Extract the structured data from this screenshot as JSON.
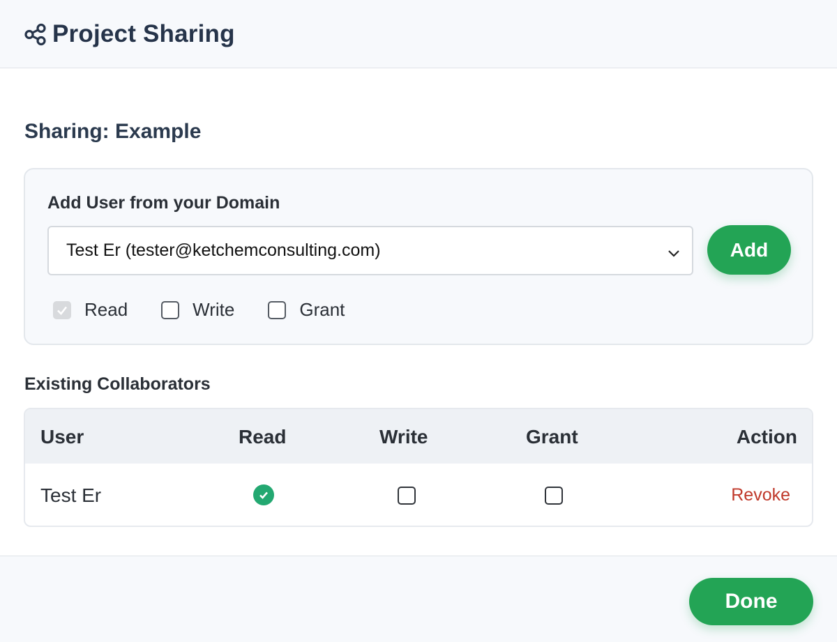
{
  "header": {
    "title": "Project Sharing",
    "icon": "share-icon"
  },
  "body": {
    "section_title": "Sharing: Example",
    "add_user": {
      "label": "Add User from your Domain",
      "selected_user": "Test Er (tester@ketchemconsulting.com)",
      "add_button_label": "Add",
      "permissions": [
        {
          "label": "Read",
          "checked": true,
          "disabled": true
        },
        {
          "label": "Write",
          "checked": false,
          "disabled": false
        },
        {
          "label": "Grant",
          "checked": false,
          "disabled": false
        }
      ]
    },
    "collaborators": {
      "title": "Existing Collaborators",
      "columns": {
        "user": "User",
        "read": "Read",
        "write": "Write",
        "grant": "Grant",
        "action": "Action"
      },
      "rows": [
        {
          "user": "Test Er",
          "read": true,
          "write": false,
          "grant": false,
          "action": "Revoke"
        }
      ]
    }
  },
  "footer": {
    "done_label": "Done"
  },
  "colors": {
    "accent": "#23a455",
    "revoke": "#c0392b",
    "check": "#23a871"
  }
}
